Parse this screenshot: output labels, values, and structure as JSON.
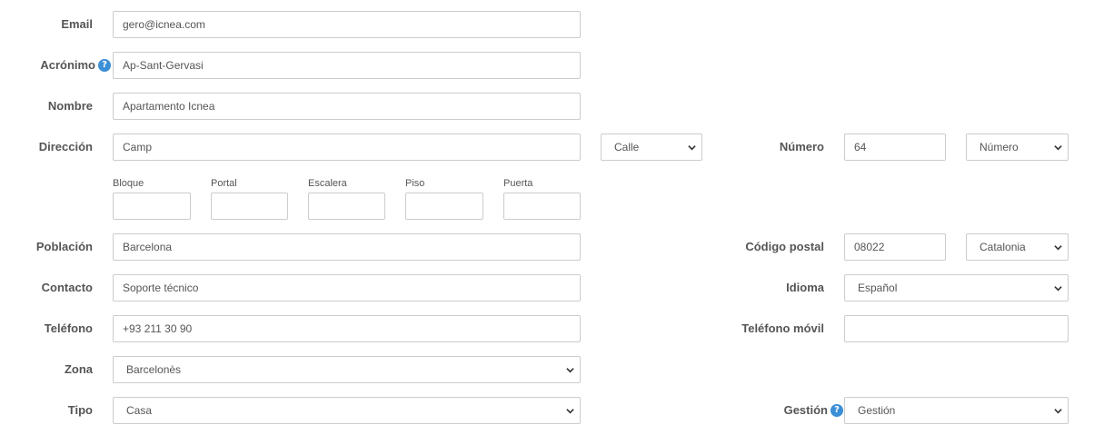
{
  "form": {
    "email": {
      "label": "Email",
      "value": "gero@icnea.com"
    },
    "acronimo": {
      "label": "Acrónimo",
      "value": "Ap-Sant-Gervasi",
      "help_icon": "question-circle-icon"
    },
    "nombre": {
      "label": "Nombre",
      "value": "Apartamento Icnea"
    },
    "direccion": {
      "label": "Dirección",
      "value": "Camp",
      "street_type": "Calle"
    },
    "numero": {
      "label": "Número",
      "value": "64",
      "suffix": "Número"
    },
    "sub_fields": [
      {
        "label": "Bloque",
        "value": ""
      },
      {
        "label": "Portal",
        "value": ""
      },
      {
        "label": "Escalera",
        "value": ""
      },
      {
        "label": "Piso",
        "value": ""
      },
      {
        "label": "Puerta",
        "value": ""
      }
    ],
    "poblacion": {
      "label": "Población",
      "value": "Barcelona"
    },
    "codigo_postal": {
      "label": "Código postal",
      "value": "08022",
      "region": "Catalonia"
    },
    "contacto": {
      "label": "Contacto",
      "value": "Soporte técnico"
    },
    "idioma": {
      "label": "Idioma",
      "value": "Español"
    },
    "telefono": {
      "label": "Teléfono",
      "value": "+93 211 30 90"
    },
    "telefono_movil": {
      "label": "Teléfono móvil",
      "value": ""
    },
    "zona": {
      "label": "Zona",
      "value": "Barcelonès"
    },
    "tipo": {
      "label": "Tipo",
      "value": "Casa"
    },
    "gestion": {
      "label": "Gestión",
      "value": "Gestión",
      "help_icon": "question-circle-icon"
    }
  },
  "colors": {
    "accent": "#3b8fd6",
    "border": "#cccccc",
    "label": "#555555"
  }
}
